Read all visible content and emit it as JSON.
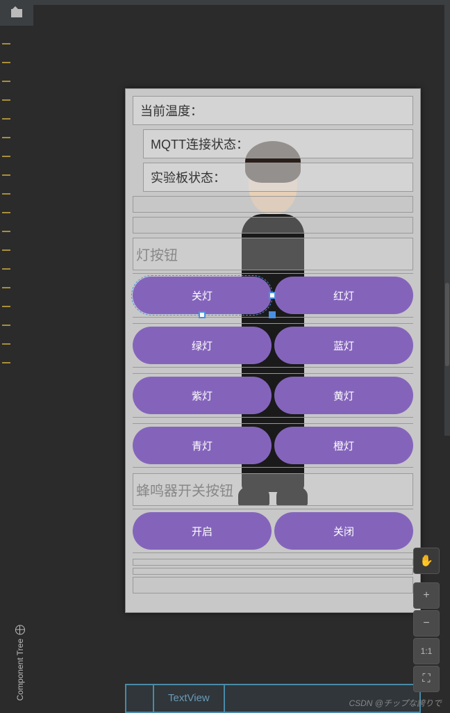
{
  "status": {
    "temperature_label": "当前温度：",
    "mqtt_label": "MQTT连接状态：",
    "board_label": "实验板状态："
  },
  "sections": {
    "lights_label": "灯按钮",
    "buzzer_label": "蜂鸣器开关按钮"
  },
  "buttons": {
    "off": "关灯",
    "red": "红灯",
    "green": "绿灯",
    "blue": "蓝灯",
    "purple": "紫灯",
    "yellow": "黄灯",
    "cyan": "青灯",
    "orange": "橙灯",
    "open": "开启",
    "close": "关闭"
  },
  "zoom": {
    "ratio_label": "1:1"
  },
  "panels": {
    "component_tree": "Component Tree",
    "textview": "TextView"
  },
  "watermark": "CSDN @チップな誇りで"
}
